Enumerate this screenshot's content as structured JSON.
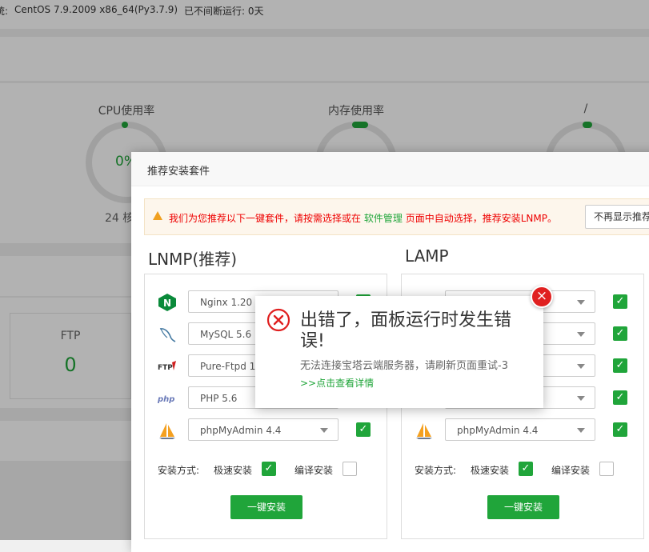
{
  "topbar": {
    "system_label": "统:",
    "system_value": "CentOS 7.9.2009 x86_64(Py3.7.9)",
    "uptime": "已不间断运行: 0天"
  },
  "gauges": [
    {
      "title": "CPU使用率",
      "value": "0%",
      "sub": "24 核"
    },
    {
      "title": "内存使用率",
      "value": "",
      "sub": ""
    },
    {
      "title": "/",
      "value": "",
      "sub": ""
    }
  ],
  "stats": {
    "ftp_label": "FTP",
    "ftp_value": "0"
  },
  "recommend": {
    "title": "推荐安装套件",
    "warn_prefix": "我们为您推荐以下一键套件，请按需选择或在",
    "warn_link": "软件管理",
    "warn_suffix": "页面中自动选择，推荐安装LNMP。",
    "no_more_button": "不再显示推荐",
    "lnmp": {
      "title": "LNMP(推荐)",
      "items": [
        {
          "icon": "nginx-icon",
          "label": "Nginx 1.20",
          "checked": true
        },
        {
          "icon": "mysql-icon",
          "label": "MySQL 5.6",
          "checked": true
        },
        {
          "icon": "ftp-icon",
          "label": "Pure-Ftpd 1",
          "checked": true
        },
        {
          "icon": "php-icon",
          "label": "PHP 5.6",
          "checked": true
        },
        {
          "icon": "phpmyadmin-icon",
          "label": "phpMyAdmin 4.4",
          "checked": true
        }
      ],
      "mode_label": "安装方式:",
      "fast_label": "极速安装",
      "compile_label": "编译安装",
      "install_button": "一键安装"
    },
    "lamp": {
      "title": "LAMP",
      "items": [
        {
          "icon": "apache-icon",
          "label": "",
          "checked": true
        },
        {
          "icon": "mysql-icon",
          "label": "",
          "checked": true
        },
        {
          "icon": "ftp-icon",
          "label": "",
          "checked": true
        },
        {
          "icon": "php-icon",
          "label": "",
          "checked": true
        },
        {
          "icon": "phpmyadmin-icon",
          "label": "phpMyAdmin 4.4",
          "checked": true
        }
      ],
      "mode_label": "安装方式:",
      "fast_label": "极速安装",
      "compile_label": "编译安装",
      "install_button": "一键安装"
    }
  },
  "error": {
    "title": "出错了，面板运行时发生错误!",
    "message": "无法连接宝塔云端服务器，请刷新页面重试-3",
    "link": ">>点击查看详情",
    "close": "×"
  },
  "colors": {
    "accent": "#20a53a",
    "error": "#e02020",
    "warning": "#f0a020"
  }
}
